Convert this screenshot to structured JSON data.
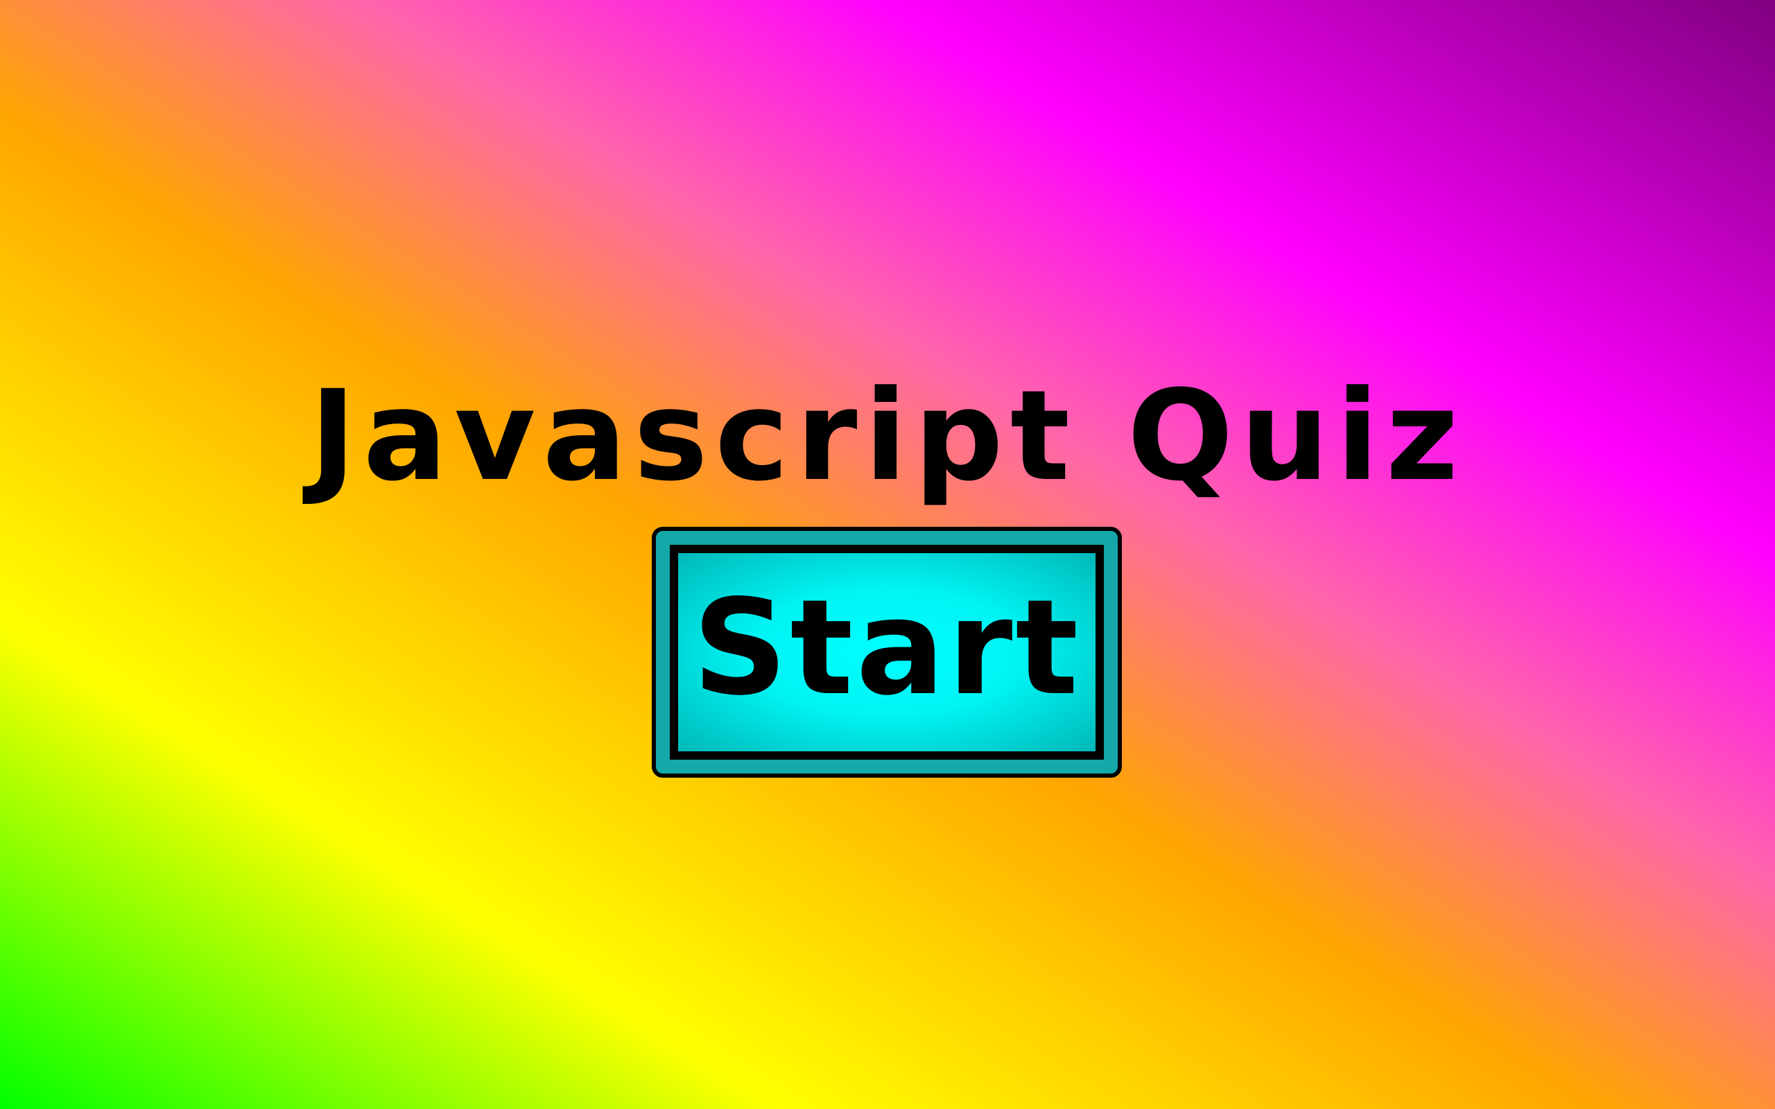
{
  "page": {
    "title": "Javascript Quiz"
  },
  "start_button": {
    "label": "Start"
  },
  "colors": {
    "title_text": "#000000",
    "button_frame": "#14a8a8",
    "button_face": "#00ffff",
    "button_border": "#000000",
    "gradient_stops": [
      "#00ff00",
      "#ffff00",
      "#ffa500",
      "#ff66aa",
      "#ff00ff",
      "#800080"
    ]
  }
}
